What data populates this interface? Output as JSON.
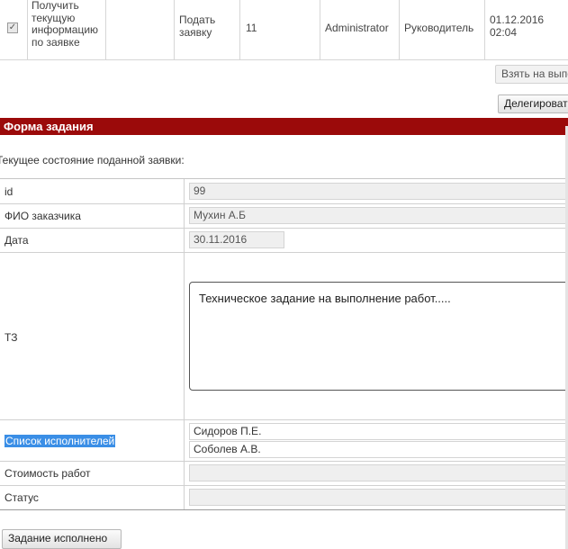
{
  "task_row": {
    "checkbox": "✓",
    "description": [
      "Получить",
      "текущую",
      "информацию",
      "по заявке"
    ],
    "action": [
      "Подать",
      "заявку"
    ],
    "number": "11",
    "author": "Administrator",
    "role": "Руководитель",
    "datetime": [
      "01.12.2016",
      "02:04"
    ]
  },
  "buttons": {
    "take": "Взять на выполнение",
    "delegate": "Делегировать",
    "done": "Задание исполнено"
  },
  "form": {
    "title": "Форма задания",
    "subtitle": "Текущее состояние поданной заявки:",
    "fields": {
      "id": {
        "label": "id",
        "value": "99"
      },
      "customer": {
        "label": "ФИО заказчика",
        "value": "Мухин А.Б"
      },
      "date": {
        "label": "Дата",
        "value": "30.11.2016"
      },
      "tz": {
        "label": "ТЗ",
        "value": "Техническое задание на выполнение работ....."
      },
      "executors": {
        "label": "Список исполнителей",
        "items": [
          "Сидоров П.Е.",
          "Соболев А.В."
        ]
      },
      "cost": {
        "label": "Стоимость работ",
        "value": ""
      },
      "status": {
        "label": "Статус",
        "value": ""
      }
    }
  }
}
